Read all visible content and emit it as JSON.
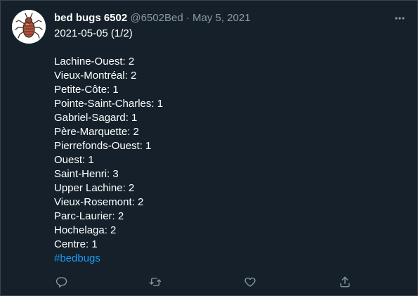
{
  "tweet": {
    "display_name": "bed bugs 6502",
    "handle": "@6502Bed",
    "separator": "·",
    "date": "May 5, 2021",
    "text_lines": [
      "2021-05-05 (1/2)",
      "",
      "Lachine-Ouest: 2",
      "Vieux-Montréal: 2",
      "Petite-Côte: 1",
      "Pointe-Saint-Charles: 1",
      "Gabriel-Sagard: 1",
      "Père-Marquette: 2",
      "Pierrefonds-Ouest: 1",
      "Ouest: 1",
      "Saint-Henri: 3",
      "Upper Lachine: 2",
      "Vieux-Rosemont: 2",
      "Parc-Laurier: 2",
      "Hochelaga: 2",
      "Centre: 1"
    ],
    "hashtag": "#bedbugs"
  },
  "icons": {
    "more": "more-dots-icon",
    "reply": "reply-bubble-icon",
    "retweet": "retweet-icon",
    "like": "heart-icon",
    "share": "share-icon"
  },
  "colors": {
    "background": "#15202b",
    "text": "#ffffff",
    "secondary": "#8b98a5",
    "link": "#1d9bf0"
  }
}
